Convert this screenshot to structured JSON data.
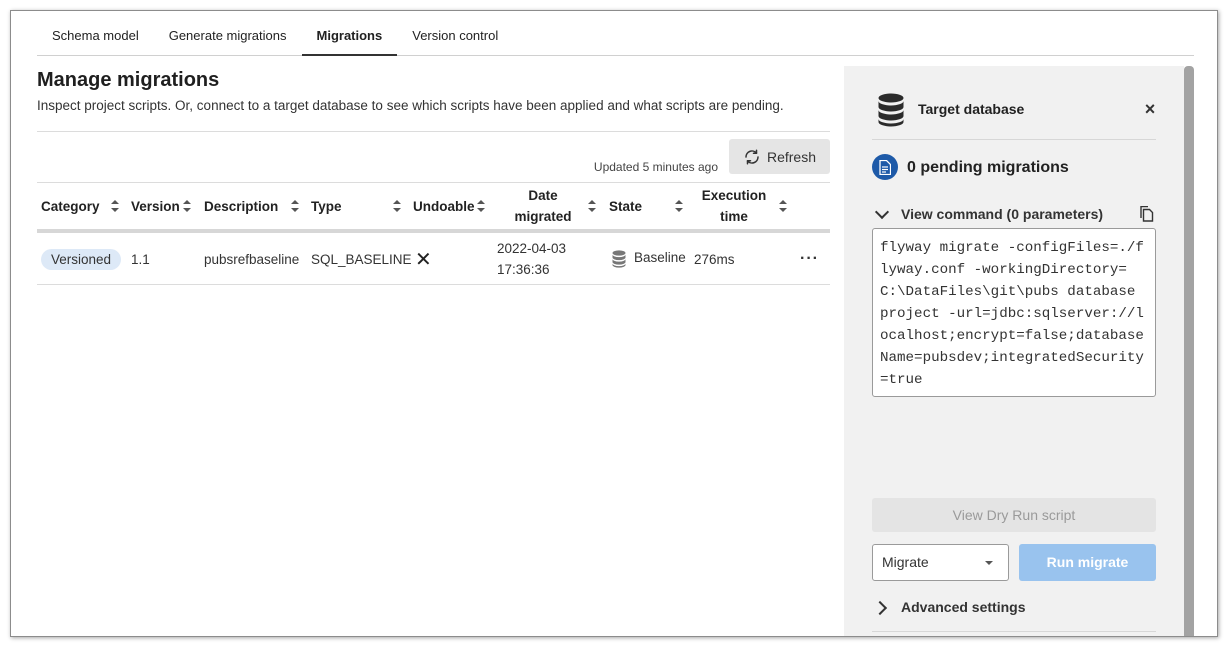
{
  "tabs": [
    {
      "label": "Schema model"
    },
    {
      "label": "Generate migrations"
    },
    {
      "label": "Migrations"
    },
    {
      "label": "Version control"
    }
  ],
  "active_tab": "Migrations",
  "main": {
    "title": "Manage migrations",
    "subtitle": "Inspect project scripts. Or, connect to a target database to see which scripts have been applied and what scripts are pending.",
    "updated_text": "Updated 5 minutes ago",
    "refresh_label": "Refresh"
  },
  "table": {
    "columns": {
      "category": "Category",
      "version": "Version",
      "description": "Description",
      "type": "Type",
      "undoable": "Undoable",
      "date_line1": "Date",
      "date_line2": "migrated",
      "state": "State",
      "exec_line1": "Execution",
      "exec_line2": "time"
    },
    "rows": [
      {
        "category": "Versioned",
        "version": "1.1",
        "description": "pubsrefbaseline",
        "type": "SQL_BASELINE",
        "undoable": "✕",
        "date_line1": "2022-04-03",
        "date_line2": "17:36:36",
        "state": "Baseline",
        "exec_time": "276ms",
        "actions": "···"
      }
    ]
  },
  "panel": {
    "title": "Target database",
    "close": "×",
    "pending": "0 pending migrations",
    "view_command": "View command (0 parameters)",
    "command": "flyway migrate -configFiles=./flyway.conf -workingDirectory=C:\\DataFiles\\git\\pubs database project -url=jdbc:sqlserver://localhost;encrypt=false;databaseName=pubsdev;integratedSecurity=true",
    "dry_run": "View Dry Run script",
    "select_value": "Migrate",
    "run": "Run migrate",
    "advanced": "Advanced settings"
  },
  "icons": {
    "refresh": "refresh-icon",
    "database": "database-icon",
    "pending": "document-icon",
    "copy": "copy-icon",
    "close": "close-icon"
  },
  "colors": {
    "pill_bg": "#dde9f7",
    "primary_disabled": "#99c3ee",
    "pending_icon": "#1e5aa8"
  }
}
